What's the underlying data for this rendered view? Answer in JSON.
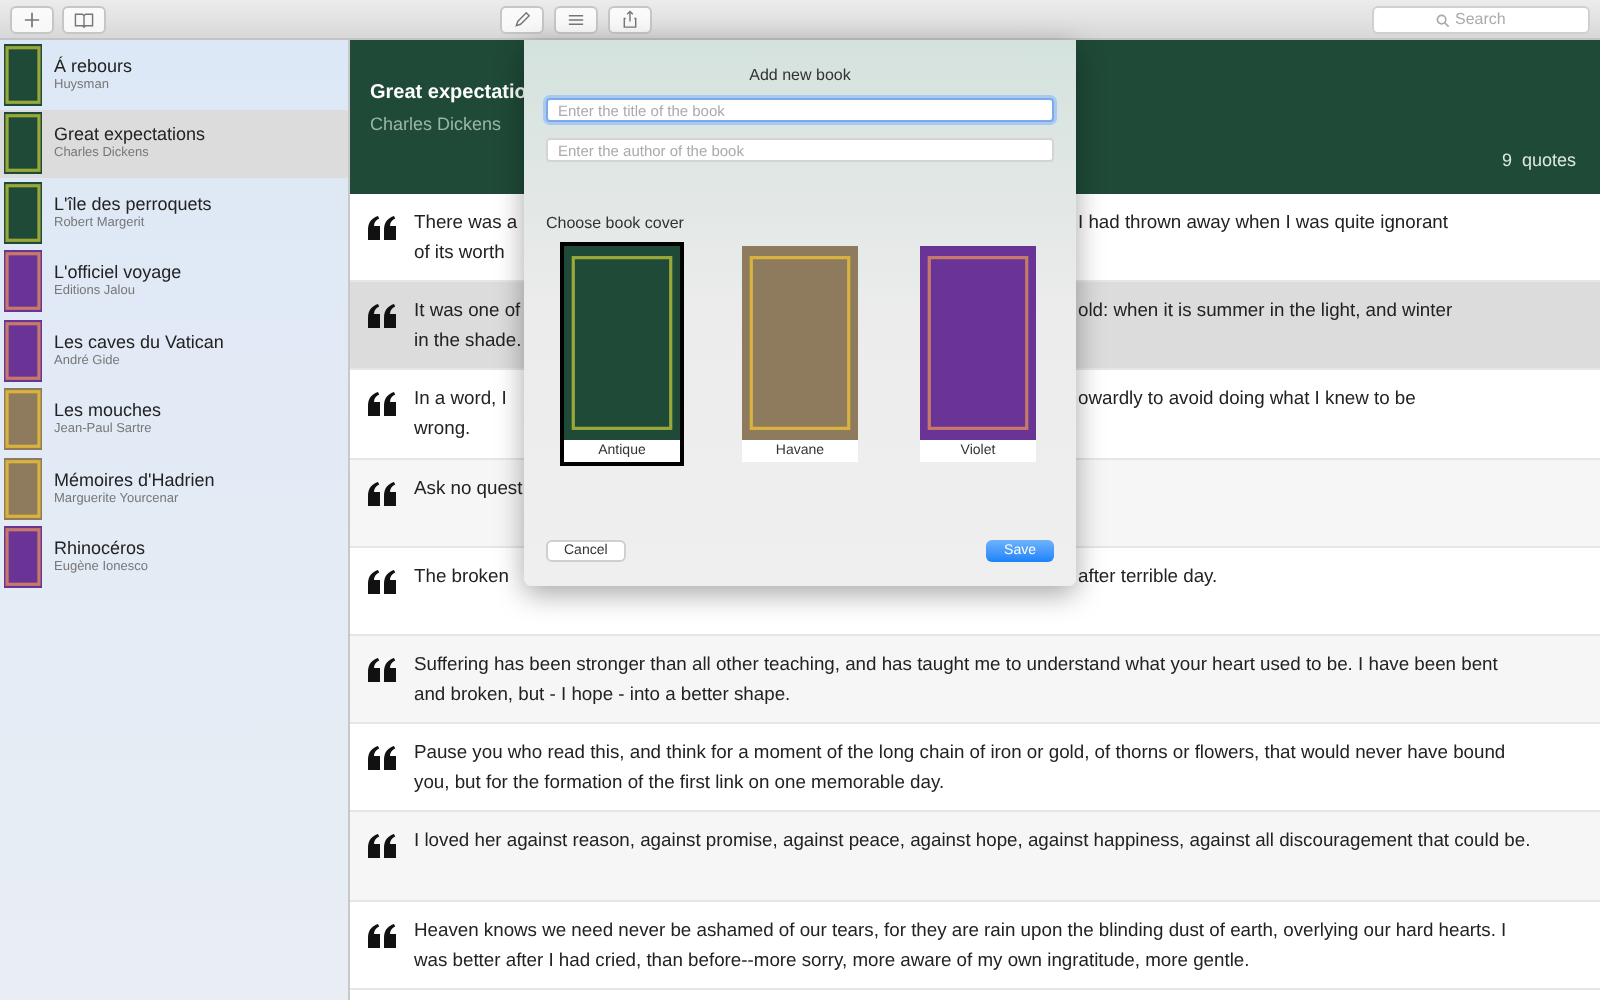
{
  "toolbar": {
    "left_buttons": [
      {
        "kind": "plus"
      },
      {
        "kind": "book"
      }
    ],
    "center_buttons": [
      {
        "kind": "pencil"
      },
      {
        "kind": "list"
      },
      {
        "kind": "share"
      }
    ],
    "search": {
      "placeholder": "Search"
    }
  },
  "sidebar": {
    "books": [
      {
        "title": "Á rebours",
        "author": "Huysman",
        "color": "#1f4a37",
        "selected": false
      },
      {
        "title": "Great expectations",
        "author": "Charles Dickens",
        "color": "#1f4a37",
        "selected": true
      },
      {
        "title": "L'île des perroquets",
        "author": "Robert Margerit",
        "color": "#1f4a37",
        "selected": false
      },
      {
        "title": "L'officiel voyage",
        "author": "Editions Jalou",
        "color": "#6a3497",
        "selected": false
      },
      {
        "title": "Les caves du Vatican",
        "author": "André Gide",
        "color": "#6a3497",
        "selected": false
      },
      {
        "title": "Les mouches",
        "author": "Jean-Paul  Sartre",
        "color": "#8e7a5c",
        "selected": false
      },
      {
        "title": "Mémoires d'Hadrien",
        "author": "Marguerite Yourcenar",
        "color": "#8e7a5c",
        "selected": false
      },
      {
        "title": "Rhinocéros",
        "author": "Eugène Ionesco",
        "color": "#6a3497",
        "selected": false
      }
    ]
  },
  "header": {
    "title": "Great expectatio",
    "author": "Charles Dickens",
    "count": "9  quotes"
  },
  "quotes": [
    {
      "selected": false,
      "lines": [
        {
          "left": "There was a",
          "right": "I had thrown away when I was quite ignorant"
        },
        {
          "left": "of its worth"
        }
      ]
    },
    {
      "selected": true,
      "lines": [
        {
          "left": "It was one of",
          "right": "old: when it is summer in the light, and winter"
        },
        {
          "left": "in the shade."
        }
      ]
    },
    {
      "selected": false,
      "lines": [
        {
          "left": "In a word, I",
          "right": "owardly to avoid doing what I knew to be"
        },
        {
          "left": "wrong."
        }
      ]
    },
    {
      "selected": false,
      "lines": [
        {
          "left": "Ask no quest"
        }
      ]
    },
    {
      "selected": false,
      "lines": [
        {
          "left": "The broken",
          "right": "after terrible day."
        }
      ]
    },
    {
      "selected": false,
      "text": "Suffering has been stronger than all other teaching, and has taught me to understand what your heart used to be. I have been bent and broken, but - I hope - into a better shape."
    },
    {
      "selected": false,
      "text": "Pause you who read this, and think for a moment of the long chain of iron or gold, of thorns or flowers, that would never have bound you, but for the formation of the first link on one memorable day."
    },
    {
      "selected": false,
      "text": "I loved her against reason, against promise, against peace, against hope, against happiness, against all discouragement that could be."
    },
    {
      "selected": false,
      "text": "Heaven knows we need never be ashamed of our tears, for they are rain upon the blinding dust of earth, overlying our hard hearts. I was better after I had cried, than before--more sorry, more aware of my own ingratitude, more gentle."
    }
  ],
  "dialog": {
    "title": "Add new book",
    "title_field": {
      "placeholder": "Enter the title of the book"
    },
    "author_field": {
      "placeholder": "Enter the author of the book"
    },
    "cover_label": "Choose book cover",
    "covers": [
      {
        "label": "Antique",
        "color": "#1f4a37",
        "selected": true
      },
      {
        "label": "Havane",
        "color": "#8e7a5c",
        "selected": false
      },
      {
        "label": "Violet",
        "color": "#6a3497",
        "selected": false
      }
    ],
    "cancel": "Cancel",
    "save": "Save"
  }
}
